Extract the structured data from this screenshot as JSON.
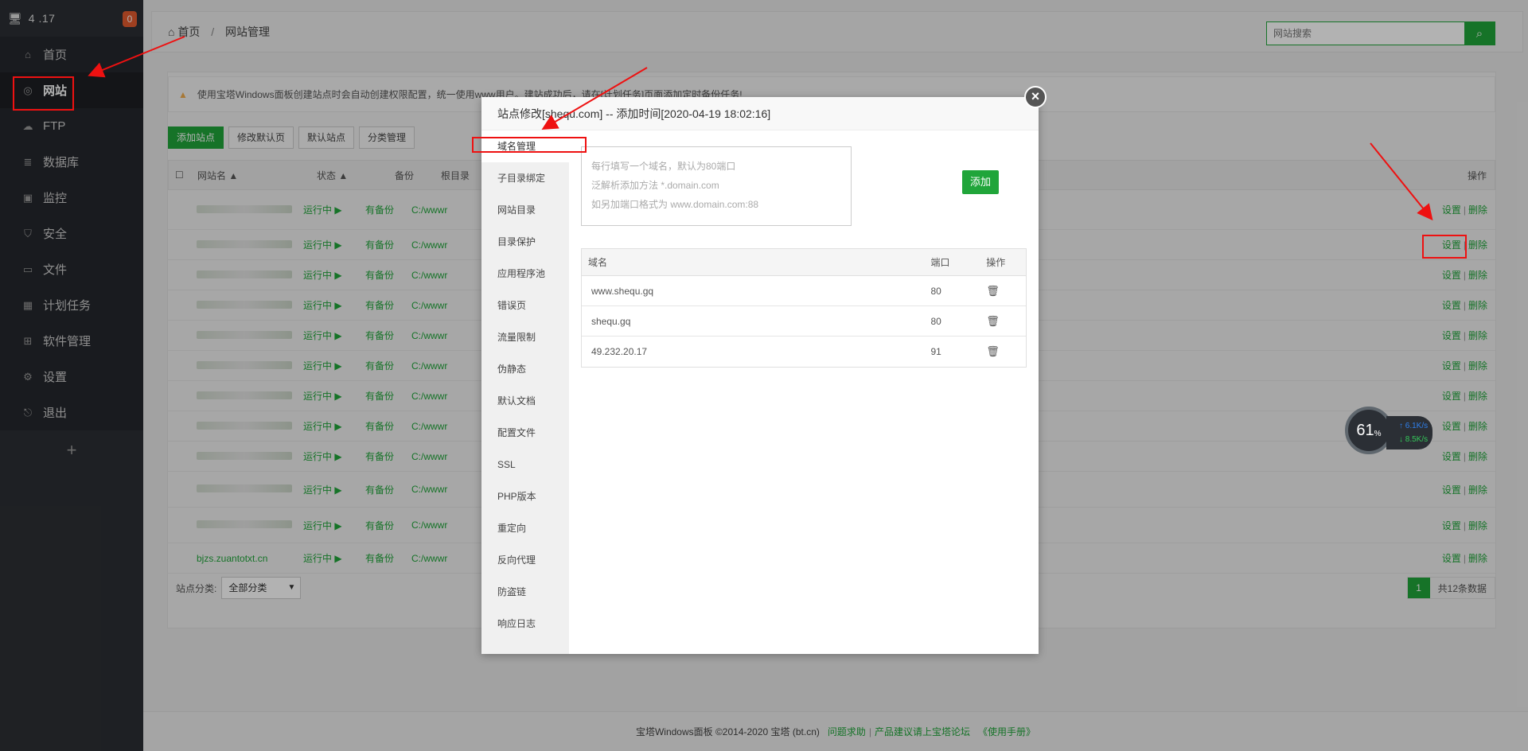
{
  "sidebar": {
    "ip": "4  .17",
    "badge": "0",
    "items": [
      {
        "label": "首页",
        "icon": "home-icon"
      },
      {
        "label": "网站",
        "icon": "globe-icon"
      },
      {
        "label": "FTP",
        "icon": "ftp-icon"
      },
      {
        "label": "数据库",
        "icon": "database-icon"
      },
      {
        "label": "监控",
        "icon": "monitor-icon"
      },
      {
        "label": "安全",
        "icon": "shield-icon"
      },
      {
        "label": "文件",
        "icon": "folder-icon"
      },
      {
        "label": "计划任务",
        "icon": "calendar-icon"
      },
      {
        "label": "软件管理",
        "icon": "grid-icon"
      },
      {
        "label": "设置",
        "icon": "gear-icon"
      },
      {
        "label": "退出",
        "icon": "logout-icon"
      }
    ],
    "plus": "+"
  },
  "breadcrumb": {
    "home": "首页",
    "sep": "/",
    "current": "网站管理"
  },
  "search": {
    "placeholder": "网站搜索"
  },
  "notice": "使用宝塔Windows面板创建站点时会自动创建权限配置，统一使用www用户。建站成功后，请在[计划任务]页面添加定时备份任务!",
  "toolbar": {
    "add": "添加站点",
    "modify_default": "修改默认页",
    "default_site": "默认站点",
    "category": "分类管理"
  },
  "table": {
    "headers": {
      "name": "网站名 ▲",
      "status": "状态 ▲",
      "backup": "备份",
      "root": "根目录",
      "ops": "操作"
    },
    "rows": [
      {
        "status": "运行中 ▶",
        "backup": "有备份",
        "path": "C:/wwwr",
        "set": "设置",
        "del": "删除"
      },
      {
        "status": "运行中 ▶",
        "backup": "有备份",
        "path": "C:/wwwr",
        "set": "设置",
        "del": "删除"
      },
      {
        "status": "运行中 ▶",
        "backup": "有备份",
        "path": "C:/wwwr",
        "set": "设置",
        "del": "删除"
      },
      {
        "status": "运行中 ▶",
        "backup": "有备份",
        "path": "C:/wwwr",
        "set": "设置",
        "del": "删除"
      },
      {
        "status": "运行中 ▶",
        "backup": "有备份",
        "path": "C:/wwwr",
        "set": "设置",
        "del": "删除"
      },
      {
        "status": "运行中 ▶",
        "backup": "有备份",
        "path": "C:/wwwr",
        "set": "设置",
        "del": "删除"
      },
      {
        "status": "运行中 ▶",
        "backup": "有备份",
        "path": "C:/wwwr",
        "set": "设置",
        "del": "删除"
      },
      {
        "status": "运行中 ▶",
        "backup": "有备份",
        "path": "C:/wwwr",
        "set": "设置",
        "del": "删除"
      },
      {
        "status": "运行中 ▶",
        "backup": "有备份",
        "path": "C:/wwwr",
        "set": "设置",
        "del": "删除"
      },
      {
        "status": "运行中 ▶",
        "backup": "有备份",
        "path": "C:/wwwr",
        "set": "设置",
        "del": "删除"
      },
      {
        "status": "运行中 ▶",
        "backup": "有备份",
        "path": "C:/wwwr",
        "set": "设置",
        "del": "删除"
      },
      {
        "status": "运行中 ▶",
        "backup": "有备份",
        "path": "C:/wwwr",
        "set": "设置",
        "del": "删除"
      }
    ],
    "last_row_name": "bjzs.zuantotxt.cn"
  },
  "footer_bar": {
    "category_label": "站点分类:",
    "category_value": "全部分类",
    "page": "1",
    "total": "共12条数据"
  },
  "footer": {
    "copyright": "宝塔Windows面板 ©2014-2020 宝塔 (bt.cn)",
    "help": "问题求助",
    "sep": "|",
    "forum": "产品建议请上宝塔论坛",
    "manual": "《使用手册》"
  },
  "widget": {
    "load": "61",
    "unit": "%",
    "up": "↑ 6.1K/s",
    "down": "↓ 8.5K/s"
  },
  "modal": {
    "title": "站点修改[shequ.com] -- 添加时间[2020-04-19 18:02:16]",
    "close": "×",
    "tabs": [
      "域名管理",
      "子目录绑定",
      "网站目录",
      "目录保护",
      "应用程序池",
      "错误页",
      "流量限制",
      "伪静态",
      "默认文档",
      "配置文件",
      "SSL",
      "PHP版本",
      "重定向",
      "反向代理",
      "防盗链",
      "响应日志"
    ],
    "textarea_lines": [
      "每行填写一个域名，默认为80端口",
      "泛解析添加方法 *.domain.com",
      "如另加端口格式为 www.domain.com:88"
    ],
    "add_button": "添加",
    "table_headers": {
      "domain": "域名",
      "port": "端口",
      "op": "操作"
    },
    "domains": [
      {
        "domain": "www.shequ.gq",
        "port": "80"
      },
      {
        "domain": "shequ.gq",
        "port": "80"
      },
      {
        "domain": "49.232.20.17",
        "port": "91"
      }
    ]
  }
}
